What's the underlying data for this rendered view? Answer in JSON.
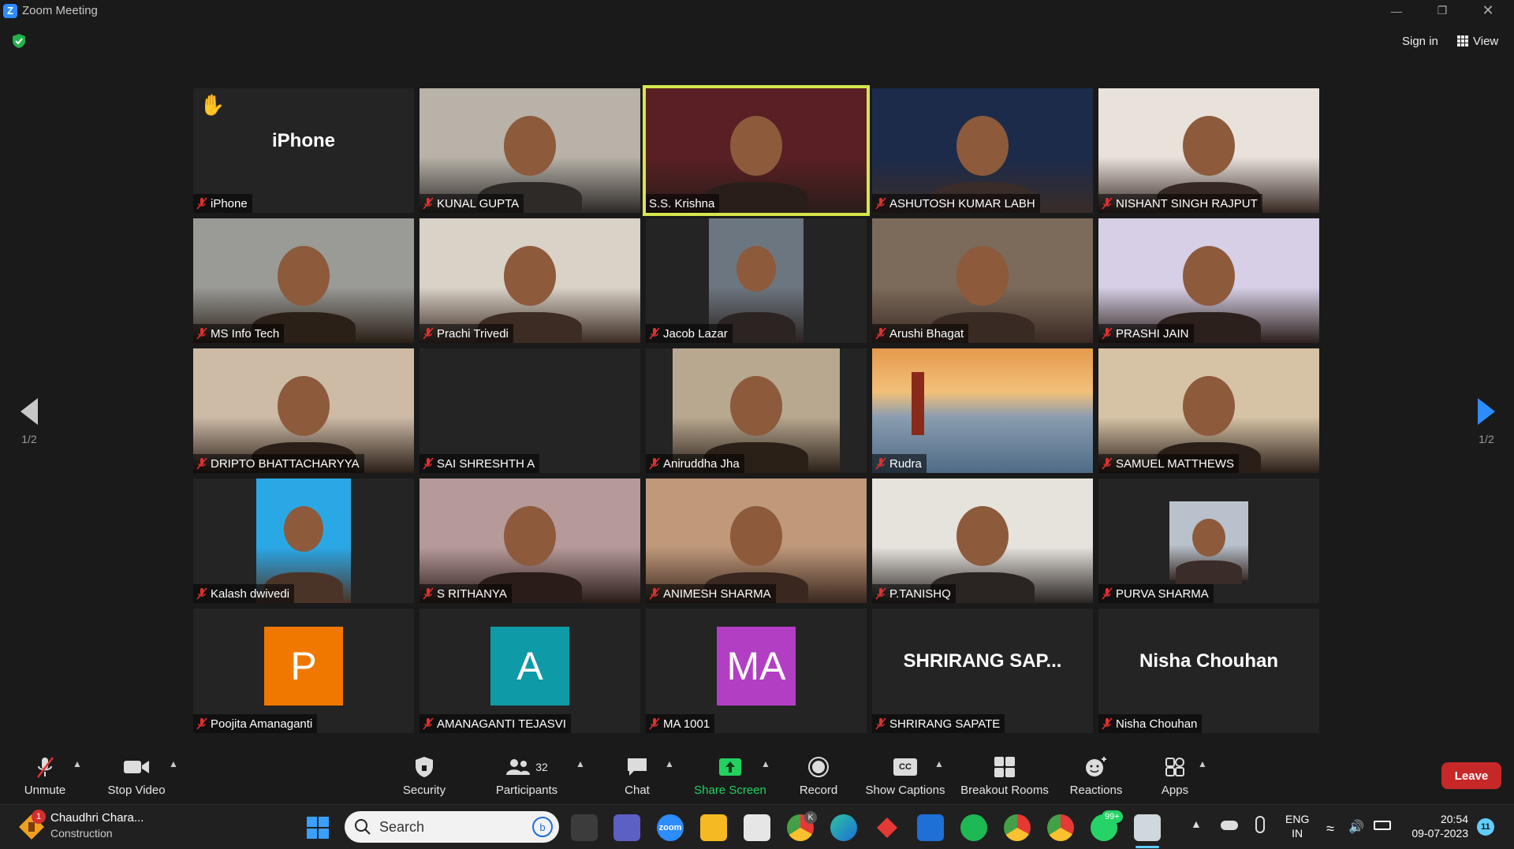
{
  "window": {
    "title": "Zoom Meeting",
    "logo": "Z"
  },
  "top_bar": {
    "sign_in": "Sign in",
    "view": "View"
  },
  "pagination": {
    "left": "1/2",
    "right": "1/2"
  },
  "participants": [
    {
      "name": "iPhone",
      "display": "iPhone",
      "type": "name",
      "raised_hand": true
    },
    {
      "name": "KUNAL GUPTA",
      "type": "video"
    },
    {
      "name": "S.S. Krishna",
      "type": "video",
      "active_speaker": true
    },
    {
      "name": "ASHUTOSH KUMAR LABH",
      "type": "video"
    },
    {
      "name": "NISHANT SINGH RAJPUT",
      "type": "video"
    },
    {
      "name": "MS Info Tech",
      "type": "video"
    },
    {
      "name": "Prachi Trivedi",
      "type": "video"
    },
    {
      "name": "Jacob Lazar",
      "type": "video"
    },
    {
      "name": "Arushi Bhagat",
      "type": "video"
    },
    {
      "name": "PRASHI JAIN",
      "type": "video"
    },
    {
      "name": "DRIPTO BHATTACHARYYA",
      "type": "video"
    },
    {
      "name": "SAI SHRESHTH A",
      "type": "empty"
    },
    {
      "name": "Aniruddha Jha",
      "type": "video"
    },
    {
      "name": "Rudra",
      "type": "image"
    },
    {
      "name": "SAMUEL MATTHEWS",
      "type": "video"
    },
    {
      "name": "Kalash dwivedi",
      "type": "video"
    },
    {
      "name": "S RITHANYA",
      "type": "video"
    },
    {
      "name": "ANIMESH SHARMA",
      "type": "video"
    },
    {
      "name": "P.TANISHQ",
      "type": "video"
    },
    {
      "name": "PURVA SHARMA",
      "type": "photo"
    },
    {
      "name": "Poojita Amanaganti",
      "type": "avatar",
      "initials": "P",
      "color": "#f07800"
    },
    {
      "name": "AMANAGANTI TEJASVI",
      "type": "avatar",
      "initials": "A",
      "color": "#0e9aa7"
    },
    {
      "name": "MA 1001",
      "type": "avatar",
      "initials": "MA",
      "color": "#b23fc3"
    },
    {
      "name": "SHRIRANG SAPATE",
      "display": "SHRIRANG  SAP...",
      "type": "name"
    },
    {
      "name": "Nisha Chouhan",
      "display": "Nisha Chouhan",
      "type": "name"
    }
  ],
  "toolbar": {
    "unmute": "Unmute",
    "stop_video": "Stop Video",
    "security": "Security",
    "participants": "Participants",
    "participants_count": "32",
    "chat": "Chat",
    "share_screen": "Share Screen",
    "record": "Record",
    "show_captions": "Show Captions",
    "captions_badge": "CC",
    "breakout_rooms": "Breakout Rooms",
    "reactions": "Reactions",
    "apps": "Apps",
    "leave": "Leave"
  },
  "taskbar": {
    "notification_title": "Chaudhri Chara...",
    "notification_subtitle": "Construction",
    "notification_count": "1",
    "search": "Search",
    "whatsapp_badge": "99+",
    "chrome_badge": "K",
    "lang_top": "ENG",
    "lang_bottom": "IN",
    "time": "20:54",
    "date": "09-07-2023",
    "notif_count": "11"
  },
  "colors": {
    "accent_share": "#23d160",
    "leave": "#c62828",
    "active_border": "#d6e64b",
    "zoom_blue": "#2d8cff"
  }
}
